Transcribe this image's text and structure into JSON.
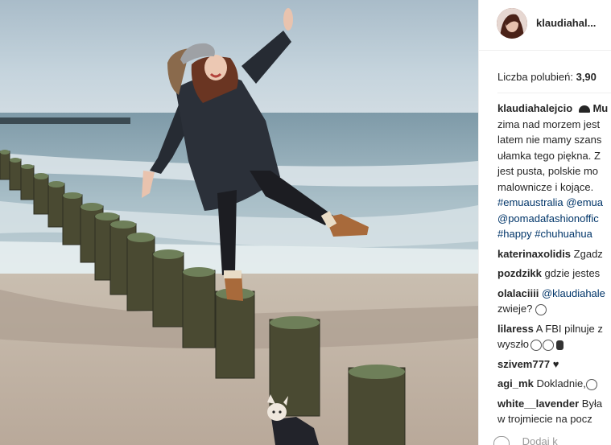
{
  "post": {
    "username": "klaudiahal...",
    "likes_label": "Liczba polubień:",
    "likes_count": "3,90"
  },
  "caption": {
    "user": "klaudiahalejcio",
    "lines": [
      "zima nad morzem jest",
      "latem nie mamy szans",
      "ułamka tego piękna. Z",
      "jest pusta, polskie mo",
      "malownicze i kojące."
    ],
    "tags1": "#emuaustralia @emua",
    "tags2": "@pomadafashionoffic",
    "tags3": "#happy #chuhuahua"
  },
  "comments": [
    {
      "user": "katerinaxolidis",
      "text": "Zgadz"
    },
    {
      "user": "pozdzikk",
      "text": "gdzie jestes"
    },
    {
      "user": "olalaciiii",
      "text": "@klaudiahale",
      "line2": "zwieje?"
    },
    {
      "user": "lilaress",
      "text": "A FBI pilnuje z",
      "line2": "wyszło"
    },
    {
      "user": "szivem777",
      "text": "♥"
    },
    {
      "user": "agi_mk",
      "text": "Dokladnie,"
    },
    {
      "user": "white__lavender",
      "text": "Była",
      "line2": "w trojmiecie na pocz"
    }
  ],
  "footer": {
    "add_comment_label": "Dodaj k"
  },
  "icons": {
    "mail": "hat-icon",
    "heart": "heart-icon"
  }
}
